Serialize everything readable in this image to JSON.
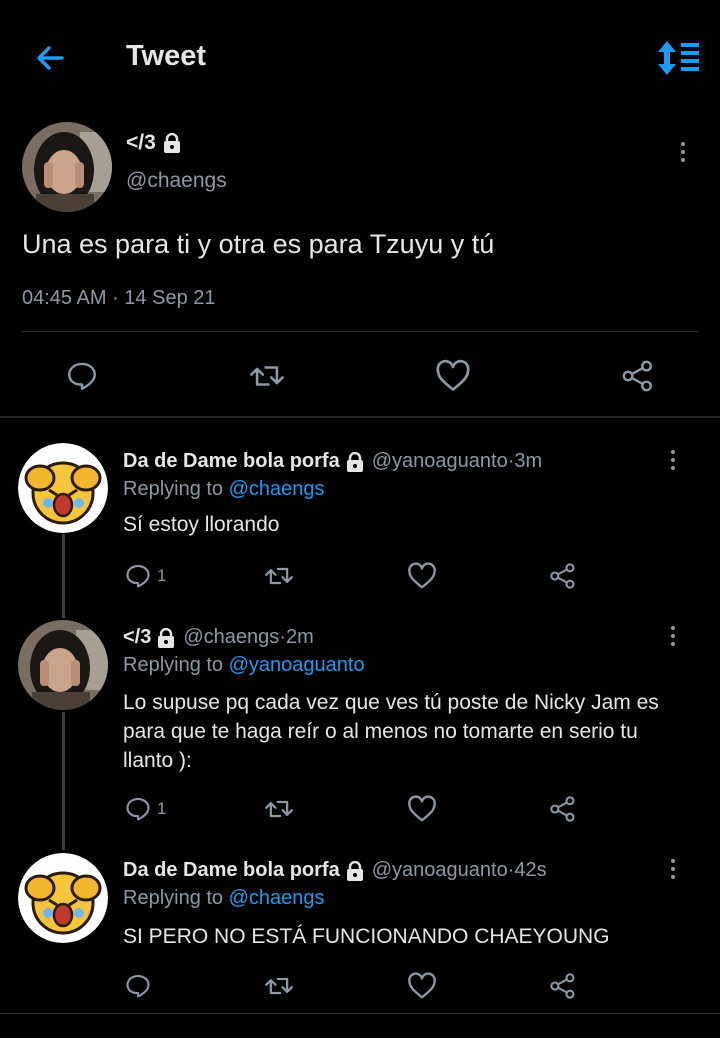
{
  "header": {
    "title": "Tweet",
    "back_icon": "arrow-left-icon",
    "sort_icon": "sort-replies-icon",
    "accent": "#1d9bf0"
  },
  "main_tweet": {
    "name": "</3",
    "handle": "@chaengs",
    "text": "Una es para ti y otra es para Tzuyu y tú",
    "time": "04:45 AM",
    "date": "14 Sep 21",
    "meta_separator": " · "
  },
  "replies": [
    {
      "name": "Da de Dame bola porfa",
      "handle": "@yanoaguanto",
      "time": "3m",
      "replying_prefix": "Replying to ",
      "replying_to": "@chaengs",
      "text": "Sí estoy llorando",
      "reply_count": "1"
    },
    {
      "name": "</3",
      "handle": "@chaengs",
      "time": "2m",
      "replying_prefix": "Replying to ",
      "replying_to": "@yanoaguanto",
      "text": "Lo supuse pq cada vez que ves tú poste de Nicky Jam es para que te haga reír o al menos no tomarte en serio tu llanto ):",
      "reply_count": "1"
    },
    {
      "name": "Da de Dame bola porfa",
      "handle": "@yanoaguanto",
      "time": "42s",
      "replying_prefix": "Replying to ",
      "replying_to": "@chaengs",
      "text": "SI PERO NO ESTÁ FUNCIONANDO CHAEYOUNG",
      "reply_count": ""
    }
  ],
  "separator": " · "
}
